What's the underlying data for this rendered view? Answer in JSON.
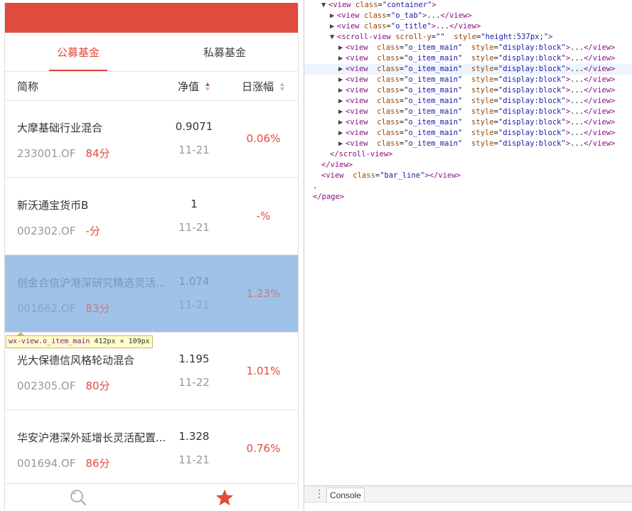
{
  "app": {
    "tabs": [
      {
        "label": "公募基金",
        "active": true
      },
      {
        "label": "私募基金",
        "active": false
      }
    ],
    "columns": {
      "name": "简称",
      "nav": "净值",
      "change": "日涨幅"
    },
    "funds": [
      {
        "name": "大摩基础行业混合",
        "code": "233001.OF",
        "score": "84分",
        "nav": "0.9071",
        "date": "11-21",
        "change": "0.06%"
      },
      {
        "name": "新沃通宝货币B",
        "code": "002302.OF",
        "score": "-分",
        "nav": "1",
        "date": "11-21",
        "change": "-%"
      },
      {
        "name": "创金合信沪港深研究精选灵活...",
        "code": "001662.OF",
        "score": "83分",
        "nav": "1.074",
        "date": "11-21",
        "change": "1.23%",
        "highlighted": true
      },
      {
        "name": "光大保德信风格轮动混合",
        "code": "002305.OF",
        "score": "80分",
        "nav": "1.195",
        "date": "11-22",
        "change": "1.01%"
      },
      {
        "name": "华安沪港深外延增长灵活配置...",
        "code": "001694.OF",
        "score": "86分",
        "nav": "1.328",
        "date": "11-21",
        "change": "0.76%"
      }
    ],
    "tooltip": {
      "selector": "wx-view.o_item_main",
      "size": "412px × 109px"
    },
    "bottom_icons": [
      "search-icon",
      "star-icon"
    ],
    "colors": {
      "brand": "#e14b3b",
      "highlight": "#9ec2e8"
    }
  },
  "devtools": {
    "console_tab": "Console",
    "tree": {
      "container_open": "<view",
      "container_attr": "class",
      "container_val": "\"container\"",
      "o_tab": "\"o_tab\"",
      "o_title": "\"o_title\"",
      "scroll_attr": "scroll-y",
      "scroll_val": "\"\"",
      "style_attr": "style",
      "scroll_style": "\"height:537px;\"",
      "item_class": "\"o_item_main\"",
      "item_style": "\"display:block\"",
      "close_scroll": "</scroll-view>",
      "close_view": "</view>",
      "bar_line": "\"bar_line\"",
      "dot": ".",
      "close_page": "</page>"
    }
  }
}
